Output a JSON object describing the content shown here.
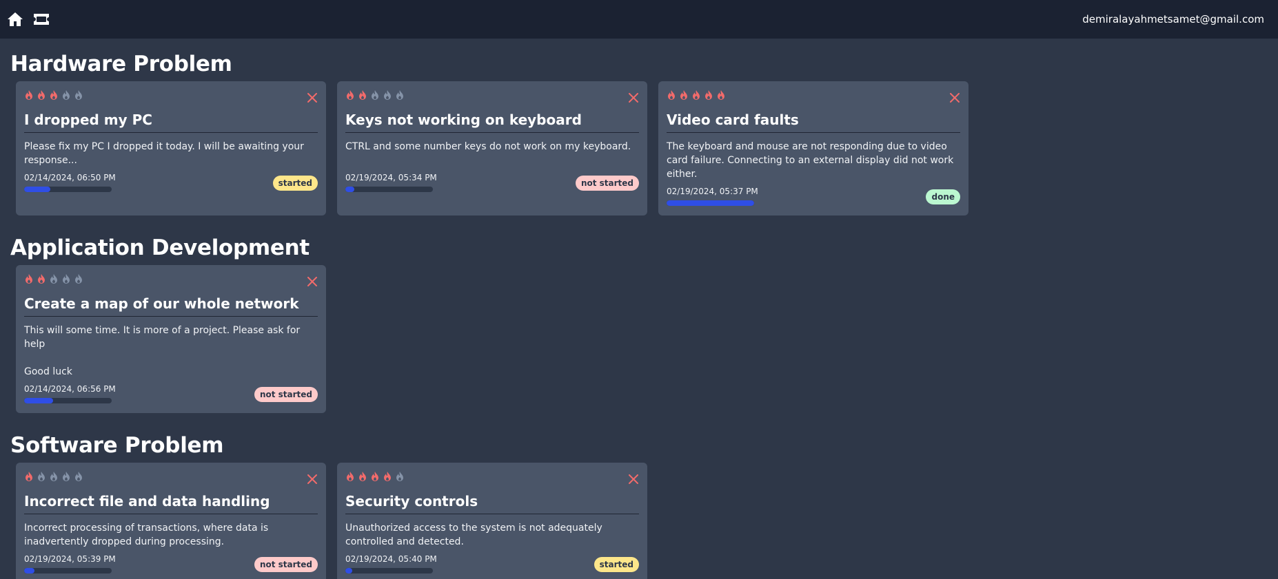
{
  "header": {
    "user_email": "demiralayahmetsamet@gmail.com"
  },
  "colors": {
    "flame_active": "#f26b6b",
    "flame_inactive": "#8593a8",
    "close": "#f26b6b",
    "progress": "#2f4ee6",
    "badge_started": "#fde68a",
    "badge_not_started": "#fecaca",
    "badge_done": "#bbf7d0"
  },
  "sections": [
    {
      "title": "Hardware Problem",
      "cards": [
        {
          "priority": 3,
          "title": "I dropped my PC",
          "description": "Please fix my PC I dropped it today. I will be awaiting your response...",
          "date": "02/14/2024, 06:50 PM",
          "progress": 0.3,
          "status": "started",
          "status_type": "started"
        },
        {
          "priority": 2,
          "title": "Keys not working on keyboard",
          "description": "CTRL and some number keys do not work on my keyboard.",
          "date": "02/19/2024, 05:34 PM",
          "progress": 0.1,
          "status": "not started",
          "status_type": "not_started"
        },
        {
          "priority": 5,
          "title": "Video card faults",
          "description": "The keyboard and mouse are not responding due to video card failure. Connecting to an external display did not work either.",
          "date": "02/19/2024, 05:37 PM",
          "progress": 1.0,
          "status": "done",
          "status_type": "done"
        }
      ]
    },
    {
      "title": "Application Development",
      "cards": [
        {
          "priority": 2,
          "title": "Create a map of our whole network",
          "description": "This will some time. It is more of a project. Please ask for help\n\nGood luck",
          "date": "02/14/2024, 06:56 PM",
          "progress": 0.33,
          "status": "not started",
          "status_type": "not_started"
        }
      ]
    },
    {
      "title": "Software Problem",
      "cards": [
        {
          "priority": 1,
          "title": "Incorrect file and data handling",
          "description": "Incorrect processing of transactions, where data is inadvertently dropped during processing.",
          "date": "02/19/2024, 05:39 PM",
          "progress": 0.12,
          "status": "not started",
          "status_type": "not_started"
        },
        {
          "priority": 4,
          "title": "Security controls",
          "description": "Unauthorized access to the system is not adequately controlled and detected.",
          "date": "02/19/2024, 05:40 PM",
          "progress": 0.06,
          "status": "started",
          "status_type": "started"
        }
      ]
    }
  ]
}
